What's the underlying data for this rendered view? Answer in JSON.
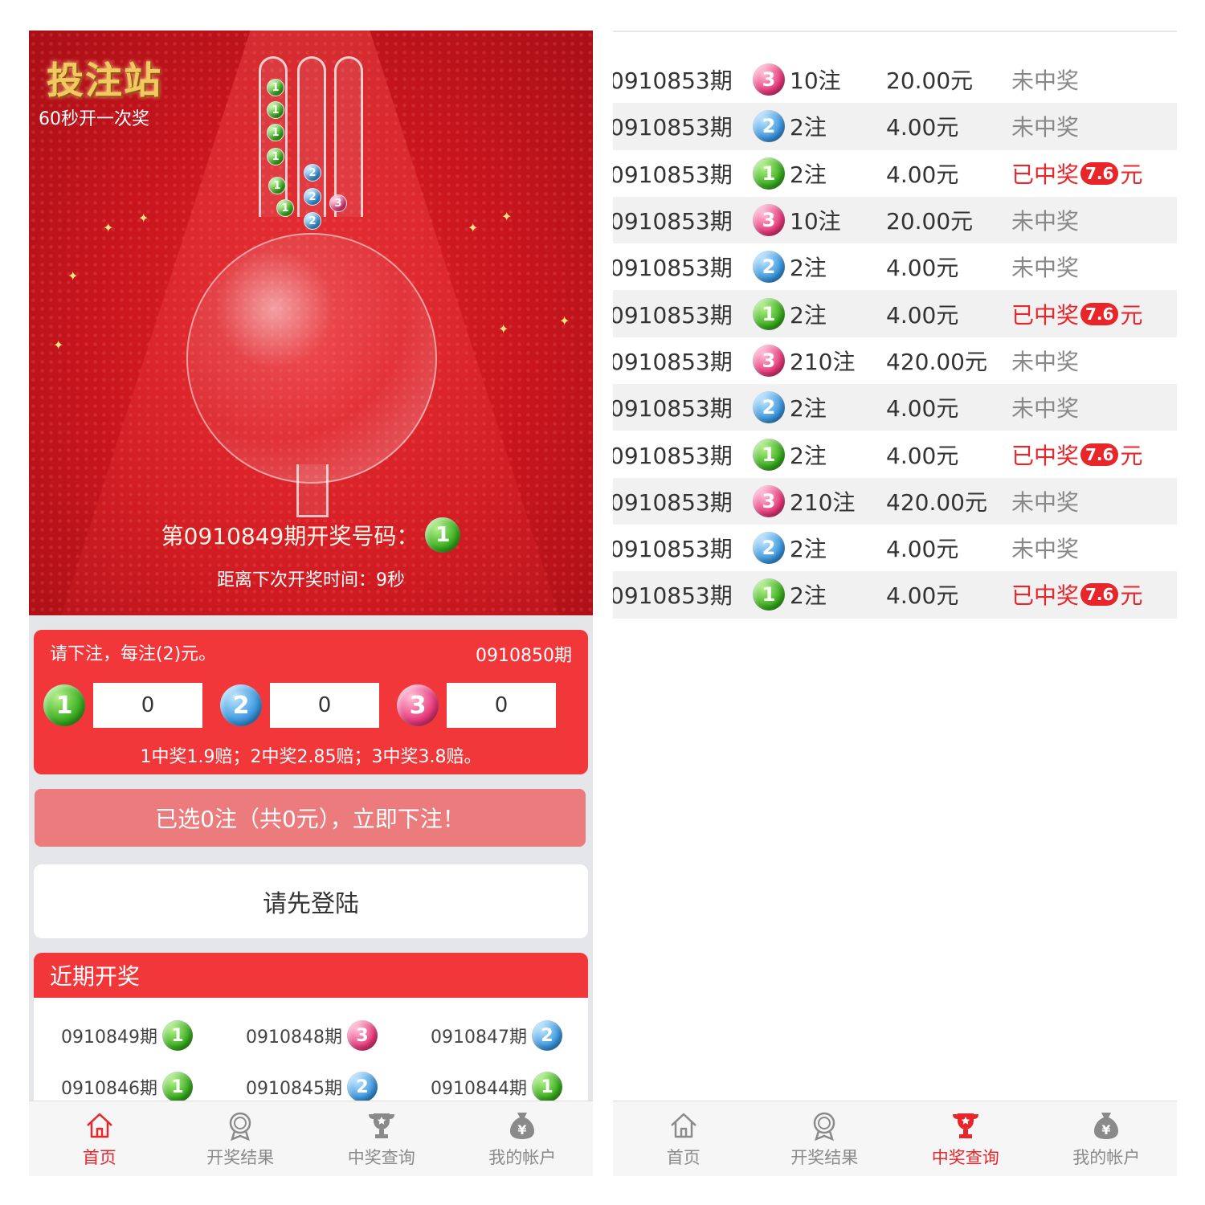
{
  "left": {
    "hero": {
      "logo": "投注站",
      "subtitle": "60秒开一次奖",
      "draw_prefix": "第0910849期开奖号码：",
      "draw_ball": "1",
      "countdown": "距离下次开奖时间：9秒"
    },
    "bet": {
      "prompt": "请下注，每注(2)元。",
      "period": "0910850期",
      "options": [
        {
          "ball": "1",
          "color": "g",
          "value": "0"
        },
        {
          "ball": "2",
          "color": "b",
          "value": "0"
        },
        {
          "ball": "3",
          "color": "p",
          "value": "0"
        }
      ],
      "odds": "1中奖1.9赔；2中奖2.85赔；3中奖3.8赔。"
    },
    "submit_label": "已选0注（共0元），立即下注！",
    "login_label": "请先登陆",
    "recent": {
      "title": "近期开奖",
      "items": [
        {
          "period": "0910849期",
          "ball": "1",
          "color": "g"
        },
        {
          "period": "0910848期",
          "ball": "3",
          "color": "p"
        },
        {
          "period": "0910847期",
          "ball": "2",
          "color": "b"
        },
        {
          "period": "0910846期",
          "ball": "1",
          "color": "g"
        },
        {
          "period": "0910845期",
          "ball": "2",
          "color": "b"
        },
        {
          "period": "0910844期",
          "ball": "1",
          "color": "g"
        }
      ]
    },
    "tabbar": {
      "home": "首页",
      "results": "开奖结果",
      "query": "中奖查询",
      "account": "我的帐户",
      "active": "home"
    }
  },
  "right": {
    "rows": [
      {
        "period": "0910853期",
        "ball": "3",
        "color": "p",
        "bets": "10注",
        "amount": "20.00元",
        "status": "未中奖"
      },
      {
        "period": "0910853期",
        "ball": "2",
        "color": "b",
        "bets": "2注",
        "amount": "4.00元",
        "status": "未中奖"
      },
      {
        "period": "0910853期",
        "ball": "1",
        "color": "g",
        "bets": "2注",
        "amount": "4.00元",
        "status_prefix": "已中奖",
        "prize": "7.6",
        "status_suffix": "元"
      },
      {
        "period": "0910853期",
        "ball": "3",
        "color": "p",
        "bets": "10注",
        "amount": "20.00元",
        "status": "未中奖"
      },
      {
        "period": "0910853期",
        "ball": "2",
        "color": "b",
        "bets": "2注",
        "amount": "4.00元",
        "status": "未中奖"
      },
      {
        "period": "0910853期",
        "ball": "1",
        "color": "g",
        "bets": "2注",
        "amount": "4.00元",
        "status_prefix": "已中奖",
        "prize": "7.6",
        "status_suffix": "元"
      },
      {
        "period": "0910853期",
        "ball": "3",
        "color": "p",
        "bets": "210注",
        "amount": "420.00元",
        "status": "未中奖"
      },
      {
        "period": "0910853期",
        "ball": "2",
        "color": "b",
        "bets": "2注",
        "amount": "4.00元",
        "status": "未中奖"
      },
      {
        "period": "0910853期",
        "ball": "1",
        "color": "g",
        "bets": "2注",
        "amount": "4.00元",
        "status_prefix": "已中奖",
        "prize": "7.6",
        "status_suffix": "元"
      },
      {
        "period": "0910853期",
        "ball": "3",
        "color": "p",
        "bets": "210注",
        "amount": "420.00元",
        "status": "未中奖"
      },
      {
        "period": "0910853期",
        "ball": "2",
        "color": "b",
        "bets": "2注",
        "amount": "4.00元",
        "status": "未中奖"
      },
      {
        "period": "0910853期",
        "ball": "1",
        "color": "g",
        "bets": "2注",
        "amount": "4.00元",
        "status_prefix": "已中奖",
        "prize": "7.6",
        "status_suffix": "元"
      }
    ],
    "tabbar": {
      "home": "首页",
      "results": "开奖结果",
      "query": "中奖查询",
      "account": "我的帐户",
      "active": "query"
    }
  },
  "colors": {
    "accent": "#f2373a",
    "active_tab": "#e8262a",
    "submit": "#eb7b7c"
  }
}
